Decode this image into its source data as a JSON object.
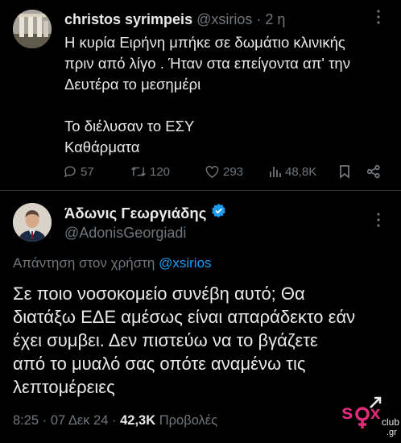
{
  "parent_tweet": {
    "display_name": "christos syrimpeis",
    "handle": "@xsirios",
    "separator": "·",
    "time_ago": "2 η",
    "body_lines": [
      "Η κυρία Ειρήνη μπήκε σε δωμάτιο κλινικής",
      "πριν από λίγο . Ήταν στα επείγοντα απ' την",
      "Δευτέρα το μεσημέρι",
      "",
      "Το διέλυσαν το ΕΣΥ",
      "Καθάρματα"
    ],
    "actions": {
      "replies": "57",
      "reposts": "120",
      "likes": "293",
      "views": "48,8K"
    },
    "icons": [
      "reply-icon",
      "repost-icon",
      "like-icon",
      "views-icon",
      "bookmark-icon",
      "share-icon",
      "more-icon"
    ]
  },
  "main_tweet": {
    "display_name": "Άδωνις Γεωργιάδης",
    "verified": true,
    "handle": "@AdonisGeorgiadi",
    "reply_prefix": "Απάντηση στον χρήστη",
    "reply_mention": "@xsirios",
    "body_lines": [
      "Σε ποιο νοσοκομείο συνέβη αυτό; Θα",
      "διατάξω ΕΔΕ αμέσως είναι απαράδεκτο εάν",
      "έχει συμβει. Δεν πιστεύω να το βγάζετε",
      "από το μυαλό σας οπότε αναμένω τις",
      "λεπτομέρειες"
    ],
    "time": "8:25",
    "separator": "·",
    "date": "07 Δεκ 24",
    "views_count": "42,3K",
    "views_label": "Προβολές"
  },
  "watermark": {
    "text": "sex club .gr"
  },
  "colors": {
    "background": "#000000",
    "text": "#e7e9ea",
    "secondary": "#71767b",
    "accent": "#1d9bf0",
    "divider": "#2f3336"
  }
}
